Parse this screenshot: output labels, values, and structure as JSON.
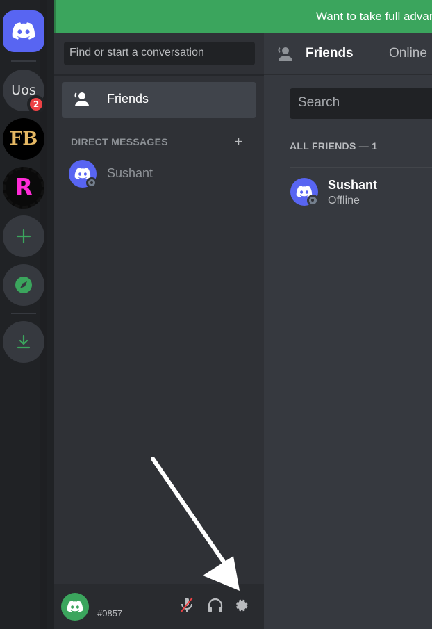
{
  "banner": {
    "text": "Want to take full advan"
  },
  "rail": {
    "servers": [
      {
        "label": "Uos",
        "badge": "2"
      },
      {
        "label": "FB"
      },
      {
        "label": "R"
      }
    ],
    "add_server_icon": "plus-icon",
    "explore_icon": "compass-icon",
    "download_icon": "download-icon"
  },
  "dm_column": {
    "search_placeholder": "Find or start a conversation",
    "friends_label": "Friends",
    "direct_messages_header": "DIRECT MESSAGES",
    "add_dm": "+",
    "dms": [
      {
        "name": "Sushant",
        "status": "offline"
      }
    ]
  },
  "user_panel": {
    "tag": "#0857",
    "icons": [
      "mic-muted-icon",
      "headphones-icon",
      "settings-gear-icon"
    ]
  },
  "main": {
    "header_title": "Friends",
    "tab_online": "Online",
    "search_placeholder": "Search",
    "all_friends_header": "ALL FRIENDS — 1",
    "friends": [
      {
        "name": "Sushant",
        "status": "Offline"
      }
    ]
  },
  "colors": {
    "blurple": "#5865f2",
    "green": "#3ba55d",
    "red": "#ed4245",
    "rail_bg": "#202225",
    "sidebar_bg": "#2f3136",
    "main_bg": "#36393f"
  }
}
